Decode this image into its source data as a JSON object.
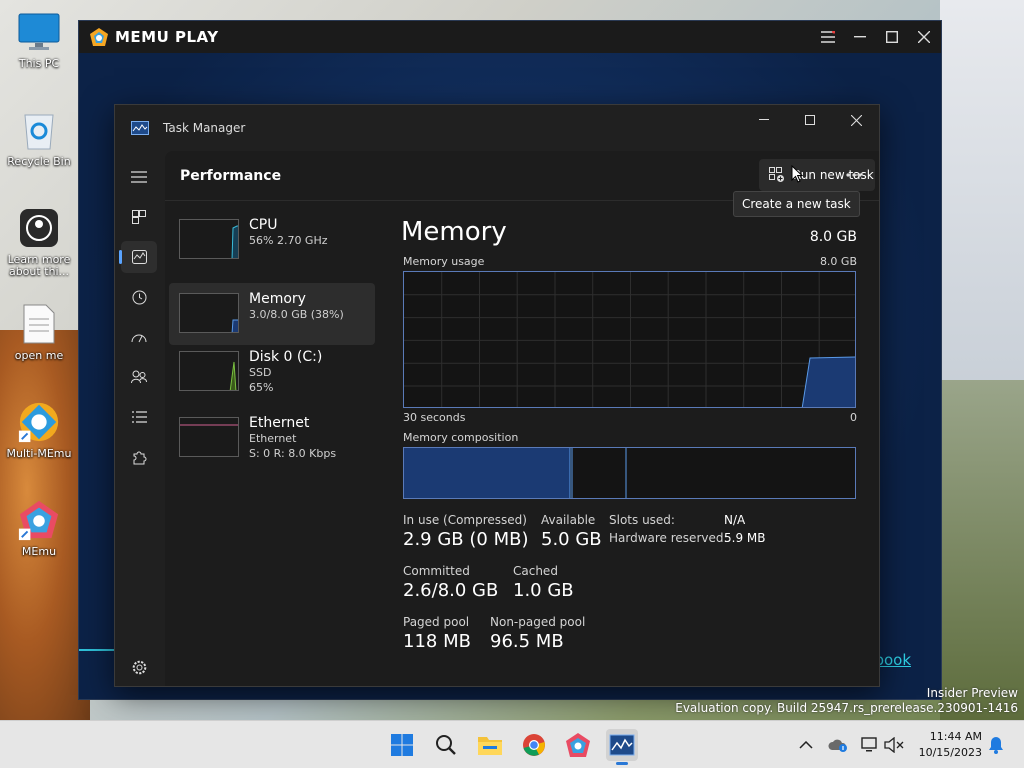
{
  "desktop": {
    "icons": [
      {
        "label": "This PC"
      },
      {
        "label": "Recycle Bin"
      },
      {
        "label": "Learn more about thi..."
      },
      {
        "label": "open me"
      },
      {
        "label": "Multi-MEmu"
      },
      {
        "label": "MEmu"
      }
    ],
    "watermark_line1": "Insider Preview",
    "watermark_line2": "Evaluation copy. Build 25947.rs_prerelease.230901-1416"
  },
  "memu": {
    "title": "MEMU PLAY",
    "link_fragment": "book"
  },
  "taskmanager": {
    "title": "Task Manager",
    "page_title": "Performance",
    "run_new_task": "Run new task",
    "tooltip": "Create a new task",
    "more_label": "...",
    "list": [
      {
        "name": "CPU",
        "sub1": "56%  2.70 GHz",
        "sub2": ""
      },
      {
        "name": "Memory",
        "sub1": "3.0/8.0 GB (38%)",
        "sub2": ""
      },
      {
        "name": "Disk 0 (C:)",
        "sub1": "SSD",
        "sub2": "65%"
      },
      {
        "name": "Ethernet",
        "sub1": "Ethernet",
        "sub2": "S: 0  R: 8.0 Kbps"
      }
    ],
    "memory": {
      "title": "Memory",
      "total": "8.0 GB",
      "usage_label": "Memory usage",
      "usage_max": "8.0 GB",
      "time_left": "30 seconds",
      "time_right": "0",
      "composition_label": "Memory composition",
      "in_use_label": "In use (Compressed)",
      "in_use_value": "2.9 GB (0 MB)",
      "available_label": "Available",
      "available_value": "5.0 GB",
      "committed_label": "Committed",
      "committed_value": "2.6/8.0 GB",
      "cached_label": "Cached",
      "cached_value": "1.0 GB",
      "paged_label": "Paged pool",
      "paged_value": "118 MB",
      "nonpaged_label": "Non-paged pool",
      "nonpaged_value": "96.5 MB",
      "slots_label": "Slots used:",
      "slots_value": "N/A",
      "hwres_label": "Hardware reserved:",
      "hwres_value": "5.9 MB"
    }
  },
  "taskbar": {
    "time": "11:44 AM",
    "date": "10/15/2023"
  },
  "colors": {
    "accent": "#5aa4ff",
    "graph_border": "#5a7ab8",
    "graph_fill": "#1b3a73"
  }
}
